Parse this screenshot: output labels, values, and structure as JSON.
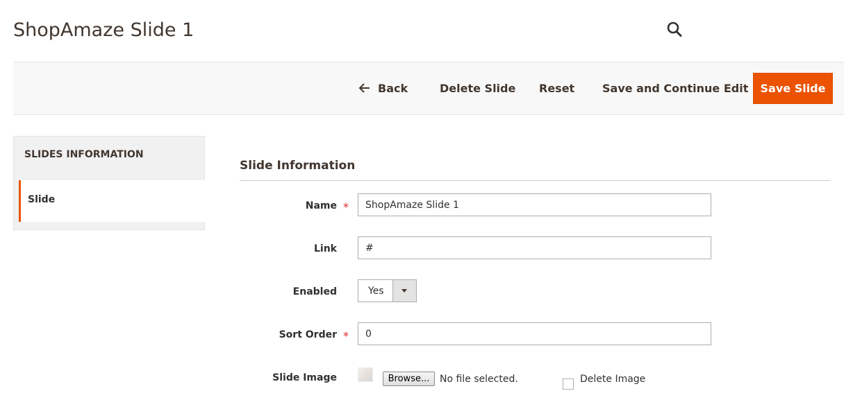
{
  "header": {
    "page_title": "ShopAmaze Slide 1",
    "search_icon": "search-icon"
  },
  "actions": {
    "back_label": "Back",
    "delete_label": "Delete Slide",
    "reset_label": "Reset",
    "save_continue_label": "Save and Continue Edit",
    "save_label": "Save Slide",
    "accent_color": "#eb5202"
  },
  "sidebar": {
    "title": "SLIDES INFORMATION",
    "items": [
      {
        "label": "Slide",
        "active": true
      }
    ]
  },
  "form": {
    "section_title": "Slide Information",
    "name": {
      "label": "Name",
      "required": true,
      "value": "ShopAmaze Slide 1"
    },
    "link": {
      "label": "Link",
      "required": false,
      "value": "#"
    },
    "enabled": {
      "label": "Enabled",
      "value": "Yes"
    },
    "sort_order": {
      "label": "Sort Order",
      "required": true,
      "value": "0"
    },
    "slide_image": {
      "label": "Slide Image",
      "browse_label": "Browse...",
      "file_status": "No file selected.",
      "delete_label": "Delete Image",
      "delete_checked": false
    }
  }
}
